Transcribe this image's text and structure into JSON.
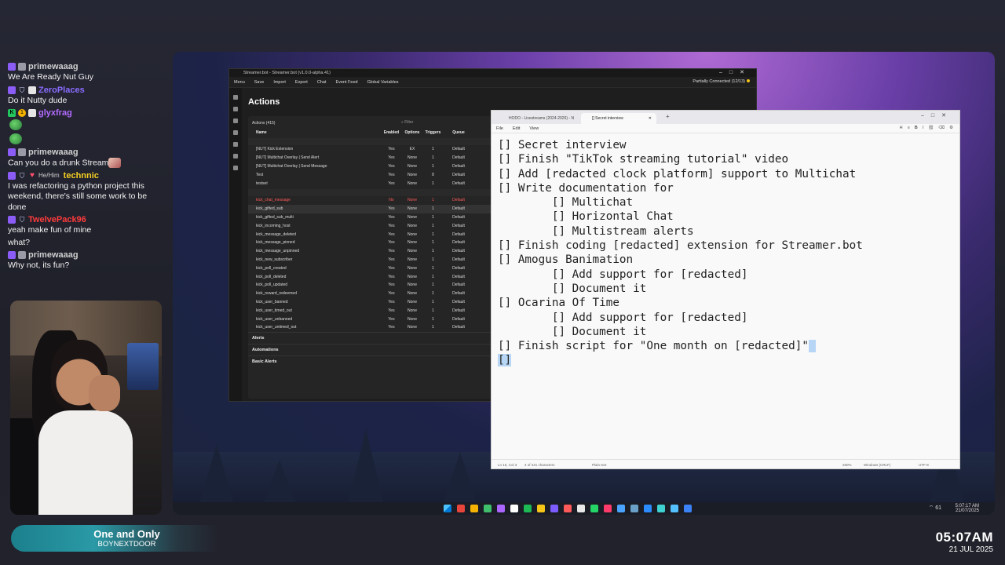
{
  "chat": [
    {
      "user": "primewaaag",
      "color": "#cfcfcf",
      "badges": [
        "tw",
        "gray"
      ],
      "text": "We Are Ready Nut Guy"
    },
    {
      "user": "ZeroPlaces",
      "color": "#8a6cff",
      "badges": [
        "tw",
        "shield",
        "white"
      ],
      "text": "Do it Nutty dude"
    },
    {
      "user": "glyxfrag",
      "color": "#b36bff",
      "badges": [
        "green",
        "gold",
        "white"
      ],
      "text": "",
      "emote": true
    },
    {
      "user": "",
      "color": "#fff",
      "badges": [],
      "text": "",
      "emote": true
    },
    {
      "user": "primewaaag",
      "color": "#cfcfcf",
      "badges": [
        "tw",
        "gray"
      ],
      "text": "Can you do a drunk Stream",
      "emote2": true
    },
    {
      "user": "technnic",
      "pronoun": "He/Him",
      "color": "#f5d020",
      "badges": [
        "tw",
        "shield",
        "heart"
      ],
      "text": "I was refactoring a python project this weekend, there's still some work to be done"
    },
    {
      "user": "TwelvePack96",
      "color": "#ff3b3b",
      "badges": [
        "tw",
        "shield"
      ],
      "text": "yeah make fun of mine"
    },
    {
      "user": "",
      "color": "#fff",
      "badges": [],
      "text": "what?"
    },
    {
      "user": "primewaaag",
      "color": "#cfcfcf",
      "badges": [
        "tw",
        "gray"
      ],
      "text": "Why not, its fun?"
    }
  ],
  "now_playing": {
    "title": "One and Only",
    "artist": "BOYNEXTDOOR"
  },
  "clock": {
    "time": "05:07AM",
    "date": "21 JUL 2025"
  },
  "taskbar": {
    "wifi": "61",
    "time": "5:07:17 AM",
    "date": "21/07/2025"
  },
  "streamerbot": {
    "window_title": "Streamer.bot - Streamer.bot (v1.0.0-alpha.41)",
    "toolbar": [
      "Menu",
      "Save",
      "Import",
      "Export",
      "Chat",
      "Event Feed",
      "Global Variables"
    ],
    "status": "Partially Connected (12/13)",
    "heading": "Actions",
    "actions_label": "Actions (415)",
    "filter_placeholder": "Filter",
    "columns": [
      "Name",
      "Enabled",
      "Options",
      "Triggers",
      "Queue"
    ],
    "rows_group1": [
      [
        "[NUT] Kick Extension",
        "Yes",
        "EX",
        "1",
        "Default"
      ],
      [
        "[NUT] Multichat Overlay | Send Alert",
        "Yes",
        "None",
        "1",
        "Default"
      ],
      [
        "[NUT] Multichat Overlay | Send Message",
        "Yes",
        "None",
        "1",
        "Default"
      ],
      [
        "Test",
        "Yes",
        "None",
        "8",
        "Default"
      ],
      [
        "testset",
        "Yes",
        "None",
        "1",
        "Default"
      ]
    ],
    "rows_group2": [
      [
        "kick_chat_message",
        "No",
        "None",
        "1",
        "Default"
      ],
      [
        "kick_gifted_sub",
        "Yes",
        "None",
        "1",
        "Default"
      ],
      [
        "kick_gifted_sub_multi",
        "Yes",
        "None",
        "1",
        "Default"
      ],
      [
        "kick_incoming_host",
        "Yes",
        "None",
        "1",
        "Default"
      ],
      [
        "kick_message_deleted",
        "Yes",
        "None",
        "1",
        "Default"
      ],
      [
        "kick_message_pinned",
        "Yes",
        "None",
        "1",
        "Default"
      ],
      [
        "kick_message_unpinned",
        "Yes",
        "None",
        "1",
        "Default"
      ],
      [
        "kick_new_subscriber",
        "Yes",
        "None",
        "1",
        "Default"
      ],
      [
        "kick_poll_created",
        "Yes",
        "None",
        "1",
        "Default"
      ],
      [
        "kick_poll_deleted",
        "Yes",
        "None",
        "1",
        "Default"
      ],
      [
        "kick_poll_updated",
        "Yes",
        "None",
        "1",
        "Default"
      ],
      [
        "kick_reward_redeemed",
        "Yes",
        "None",
        "1",
        "Default"
      ],
      [
        "kick_user_banned",
        "Yes",
        "None",
        "1",
        "Default"
      ],
      [
        "kick_user_timed_out",
        "Yes",
        "None",
        "1",
        "Default"
      ],
      [
        "kick_user_unbanned",
        "Yes",
        "None",
        "1",
        "Default"
      ],
      [
        "kick_user_untimed_out",
        "Yes",
        "None",
        "1",
        "Default"
      ]
    ],
    "sections": [
      "Alerts",
      "Automations",
      "Basic Alerts"
    ]
  },
  "notepad": {
    "tab_a": "HODO - Livestreams (2024-2026) - N",
    "tab_b": "[] Secret interview",
    "menu": [
      "File",
      "Edit",
      "View"
    ],
    "lines": [
      "[] Secret interview",
      "[] Finish \"TikTok streaming tutorial\" video",
      "[] Add [redacted clock platform] support to Multichat",
      "[] Write documentation for",
      "        [] Multichat",
      "        [] Horizontal Chat",
      "        [] Multistream alerts",
      "[] Finish coding [redacted] extension for Streamer.bot",
      "[] Amogus Banimation",
      "        [] Add support for [redacted]",
      "        [] Document it",
      "[] Ocarina Of Time",
      "        [] Add support for [redacted]",
      "        [] Document it",
      "[] Finish script for \"One month on [redacted]\"",
      "[]"
    ],
    "status": {
      "pos": "Ln 16, Col 3",
      "chars": "4 of 441 characters",
      "mode": "Plain text",
      "zoom": "260%",
      "eol": "Windows (CRLF)",
      "enc": "UTF-8"
    }
  }
}
